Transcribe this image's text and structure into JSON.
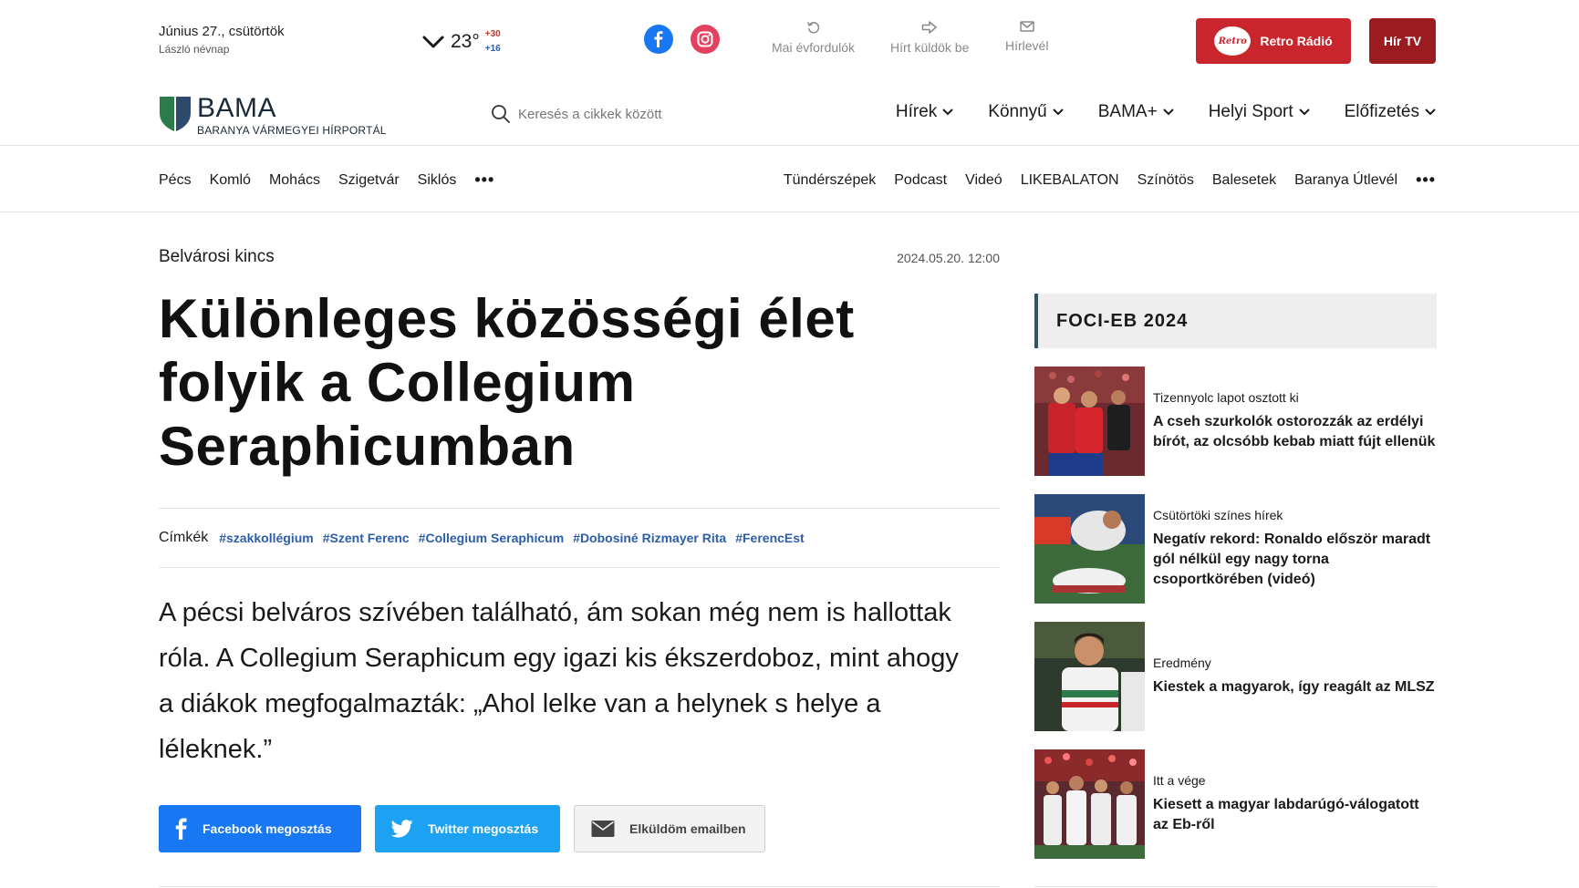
{
  "topbar": {
    "date": "Június 27., csütörtök",
    "nameday": "László névnap",
    "weather": {
      "icon": "chevron-down-icon",
      "temp": "23°",
      "max": "+30",
      "min": "+16"
    },
    "social": {
      "facebook_icon": "facebook-icon",
      "instagram_icon": "instagram-icon"
    },
    "links": [
      {
        "label": "Mai évfordulók",
        "icon": "history-icon"
      },
      {
        "label": "Hírt küldök be",
        "icon": "send-arrow-icon"
      },
      {
        "label": "Hírlevél",
        "icon": "mail-icon"
      }
    ],
    "retro_label": "Retro Rádió",
    "retro_logo_text": "Retro",
    "hirtv_label": "Hír TV",
    "colors": {
      "retro": "#c8262c",
      "hirtv": "#9b1c20"
    }
  },
  "header": {
    "logo_name": "BAMA",
    "logo_sub": "BARANYA VÁRMEGYEI HÍRPORTÁL",
    "search_placeholder": "Keresés a cikkek között",
    "nav": [
      {
        "label": "Hírek"
      },
      {
        "label": "Könnyű"
      },
      {
        "label": "BAMA+"
      },
      {
        "label": "Helyi Sport"
      },
      {
        "label": "Előfizetés"
      }
    ]
  },
  "subnav": {
    "left": [
      "Pécs",
      "Komló",
      "Mohács",
      "Szigetvár",
      "Siklós"
    ],
    "right": [
      "Tündérszépek",
      "Podcast",
      "Videó",
      "LIKEBALATON",
      "Színötös",
      "Balesetek",
      "Baranya Útlevél"
    ],
    "more": "•••"
  },
  "article": {
    "kicker": "Belvárosi kincs",
    "date": "2024.05.20. 12:00",
    "title": "Különleges közösségi élet folyik a Collegium Seraphicumban",
    "tags_label": "Címkék",
    "tags": [
      "#szakkollégium",
      "#Szent Ferenc",
      "#Collegium Seraphicum",
      "#Dobosiné Rizmayer Rita",
      "#FerencEst"
    ],
    "lead": "A pécsi belváros szívében található, ám sokan még nem is hallottak róla. A Collegium Seraphicum egy igazi kis ékszerdoboz, mint ahogy a diákok megfogalmazták: „Ahol lelke van a helynek s helye a léleknek.”",
    "share": {
      "facebook": "Facebook megosztás",
      "twitter": "Twitter megosztás",
      "email": "Elküldöm emailben"
    }
  },
  "sidebar": {
    "title": "FOCI-EB 2024",
    "items": [
      {
        "kicker": "Tizennyolc lapot osztott ki",
        "title": "A cseh szurkolók ostorozzák az erdélyi bírót, az olcsóbb kebab miatt fújt ellenük"
      },
      {
        "kicker": "Csütörtöki színes hírek",
        "title": "Negatív rekord: Ronaldo először maradt gól nélkül egy nagy torna csoportkörében (videó)"
      },
      {
        "kicker": "Eredmény",
        "title": "Kiestek a magyarok, így reagált az MLSZ"
      },
      {
        "kicker": "Itt a vége",
        "title": "Kiesett a magyar labdarúgó-válogatott az Eb-ről"
      }
    ]
  }
}
